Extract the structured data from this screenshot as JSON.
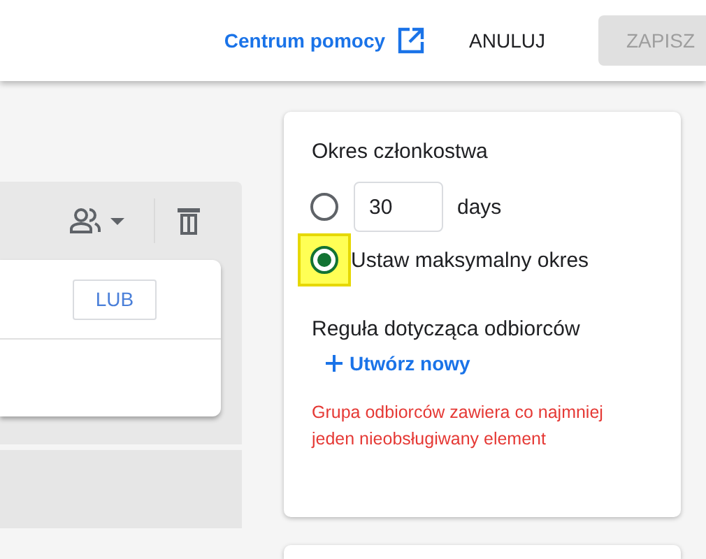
{
  "header": {
    "help_link": "Centrum pomocy",
    "cancel_button": "ANULUJ",
    "save_button": {
      "label": "ZAPISZ",
      "disabled": true
    }
  },
  "rule_panel": {
    "or_button": "LUB"
  },
  "membership": {
    "title": "Okres członkostwa",
    "options": [
      {
        "kind": "days",
        "value": "30",
        "unit": "days",
        "selected": false,
        "highlighted": false
      },
      {
        "kind": "text",
        "label": "Ustaw maksymalny okres",
        "selected": true,
        "highlighted": true
      }
    ],
    "rule_title": "Reguła dotycząca odbiorców",
    "create_link": "Utwórz nowy",
    "error": "Grupa odbiorców zawiera co najmniej jeden nieobsługiwany element"
  }
}
